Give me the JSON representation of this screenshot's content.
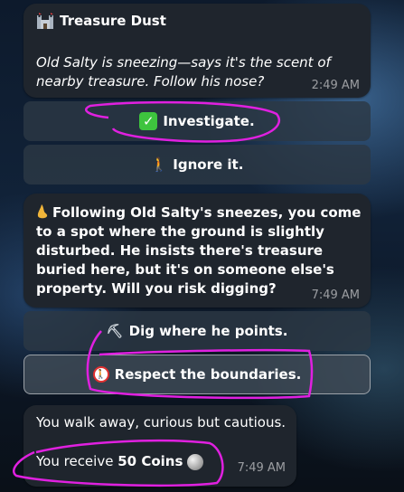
{
  "message1": {
    "title": "Treasure Dust",
    "title_icon": "castle-icon",
    "body": "Old Salty is sneezing—says it's the scent of nearby treasure. Follow his nose?",
    "time": "2:49 AM"
  },
  "buttons1": [
    {
      "label": "Investigate.",
      "icon": "check-mark-icon",
      "glyph": "✓"
    },
    {
      "label": "Ignore it.",
      "icon": "walking-person-icon",
      "glyph": "🚶"
    }
  ],
  "message2": {
    "icon": "nose-icon",
    "body": "Following Old Salty's sneezes, you come to a spot where the ground is slightly disturbed. He insists there's treasure buried here, but it's on someone else's property. Will you risk digging?",
    "time": "7:49 AM"
  },
  "buttons2": [
    {
      "label": "Dig where he points.",
      "icon": "pickaxe-icon",
      "glyph": "⛏"
    },
    {
      "label": "Respect the boundaries.",
      "icon": "no-pedestrians-icon",
      "glyph": "🚷"
    }
  ],
  "message3": {
    "line1": "You walk away, curious but cautious.",
    "receive_prefix": "You receive",
    "amount": "50 Coins",
    "coin_icon": "moon-coin-icon",
    "time": "7:49 AM"
  },
  "colors": {
    "bubble": "#1f252d",
    "annotation": "#e020e0",
    "check": "#3ec43e"
  }
}
